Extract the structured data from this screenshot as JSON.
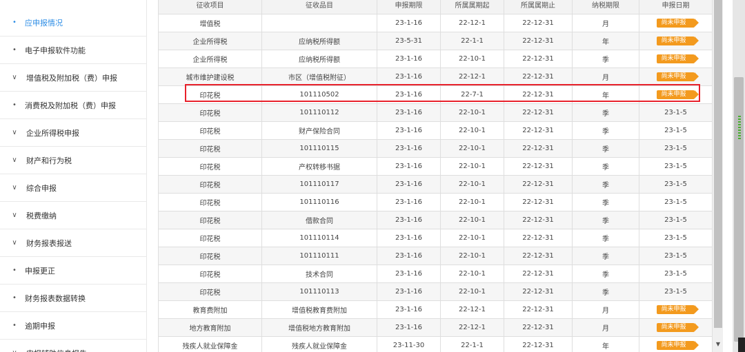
{
  "sidebar": {
    "items": [
      {
        "label": "应申报情况",
        "mark": "•",
        "active": true
      },
      {
        "label": "电子申报软件功能",
        "mark": "•"
      },
      {
        "label": "增值税及附加税（费）申报",
        "mark": "∨"
      },
      {
        "label": "消费税及附加税（费）申报",
        "mark": "•"
      },
      {
        "label": "企业所得税申报",
        "mark": "∨"
      },
      {
        "label": "财产和行为税",
        "mark": "∨"
      },
      {
        "label": "综合申报",
        "mark": "∨"
      },
      {
        "label": "税费缴纳",
        "mark": "∨"
      },
      {
        "label": "财务报表报送",
        "mark": "∨"
      },
      {
        "label": "申报更正",
        "mark": "•"
      },
      {
        "label": "财务报表数据转换",
        "mark": "•"
      },
      {
        "label": "逾期申报",
        "mark": "•"
      },
      {
        "label": "申报辅助信息报告",
        "mark": "∨"
      }
    ]
  },
  "table": {
    "headers": [
      "征收项目",
      "征收品目",
      "申报期限",
      "所属属期起",
      "所属属期止",
      "纳税期限",
      "申报日期"
    ],
    "rows": [
      [
        "增值税",
        "",
        "23-1-16",
        "22-12-1",
        "22-12-31",
        "月",
        "尚未申报"
      ],
      [
        "企业所得税",
        "应纳税所得额",
        "23-5-31",
        "22-1-1",
        "22-12-31",
        "年",
        "尚未申报"
      ],
      [
        "企业所得税",
        "应纳税所得额",
        "23-1-16",
        "22-10-1",
        "22-12-31",
        "季",
        "尚未申报"
      ],
      [
        "城市维护建设税",
        "市区（增值税附征）",
        "23-1-16",
        "22-12-1",
        "22-12-31",
        "月",
        "尚未申报"
      ],
      [
        "印花税",
        "101110502",
        "23-1-16",
        "22-7-1",
        "22-12-31",
        "年",
        "尚未申报"
      ],
      [
        "印花税",
        "101110112",
        "23-1-16",
        "22-10-1",
        "22-12-31",
        "季",
        "23-1-5"
      ],
      [
        "印花税",
        "财产保险合同",
        "23-1-16",
        "22-10-1",
        "22-12-31",
        "季",
        "23-1-5"
      ],
      [
        "印花税",
        "101110115",
        "23-1-16",
        "22-10-1",
        "22-12-31",
        "季",
        "23-1-5"
      ],
      [
        "印花税",
        "产权转移书据",
        "23-1-16",
        "22-10-1",
        "22-12-31",
        "季",
        "23-1-5"
      ],
      [
        "印花税",
        "101110117",
        "23-1-16",
        "22-10-1",
        "22-12-31",
        "季",
        "23-1-5"
      ],
      [
        "印花税",
        "101110116",
        "23-1-16",
        "22-10-1",
        "22-12-31",
        "季",
        "23-1-5"
      ],
      [
        "印花税",
        "借款合同",
        "23-1-16",
        "22-10-1",
        "22-12-31",
        "季",
        "23-1-5"
      ],
      [
        "印花税",
        "101110114",
        "23-1-16",
        "22-10-1",
        "22-12-31",
        "季",
        "23-1-5"
      ],
      [
        "印花税",
        "101110111",
        "23-1-16",
        "22-10-1",
        "22-12-31",
        "季",
        "23-1-5"
      ],
      [
        "印花税",
        "技术合同",
        "23-1-16",
        "22-10-1",
        "22-12-31",
        "季",
        "23-1-5"
      ],
      [
        "印花税",
        "101110113",
        "23-1-16",
        "22-10-1",
        "22-12-31",
        "季",
        "23-1-5"
      ],
      [
        "教育费附加",
        "增值税教育费附加",
        "23-1-16",
        "22-12-1",
        "22-12-31",
        "月",
        "尚未申报"
      ],
      [
        "地方教育附加",
        "增值税地方教育附加",
        "23-1-16",
        "22-12-1",
        "22-12-31",
        "月",
        "尚未申报"
      ],
      [
        "残疾人就业保障金",
        "残疾人就业保障金",
        "23-11-30",
        "22-1-1",
        "22-12-31",
        "年",
        "尚未申报"
      ]
    ],
    "pending_label": "尚未申报",
    "highlighted_row": 4
  },
  "colors": {
    "active_nav": "#2e8ee6",
    "badge": "#f39a1e",
    "highlight_border": "#e8202a"
  },
  "scrollbar": {
    "down_arrow": "▼"
  }
}
